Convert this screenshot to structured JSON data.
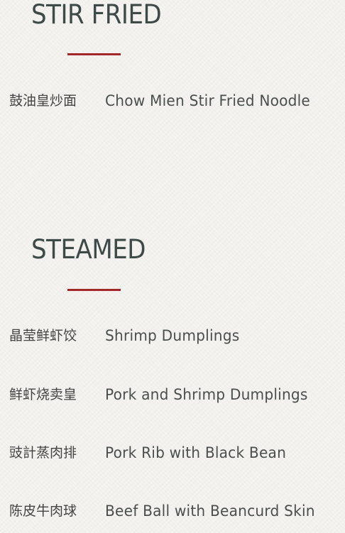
{
  "sections": [
    {
      "title": "STIR FRIED",
      "items": [
        {
          "chinese": "鼓油皇炒面",
          "english": "Chow Mien Stir Fried Noodle"
        }
      ]
    },
    {
      "title": "STEAMED",
      "items": [
        {
          "chinese": "晶莹鲜虾饺",
          "english": "Shrimp Dumplings"
        },
        {
          "chinese": "鲜虾烧卖皇",
          "english": "Pork and Shrimp Dumplings"
        },
        {
          "chinese": "豉計蒸肉排",
          "english": "Pork Rib with Black Bean"
        },
        {
          "chinese": "陈皮牛肉球",
          "english": "Beef Ball with Beancurd Skin"
        }
      ]
    }
  ],
  "colors": {
    "accent_divider": "#a3262b",
    "heading_text": "#3e4a48",
    "body_text": "#4a4f4e",
    "background": "#f3f1ee"
  }
}
